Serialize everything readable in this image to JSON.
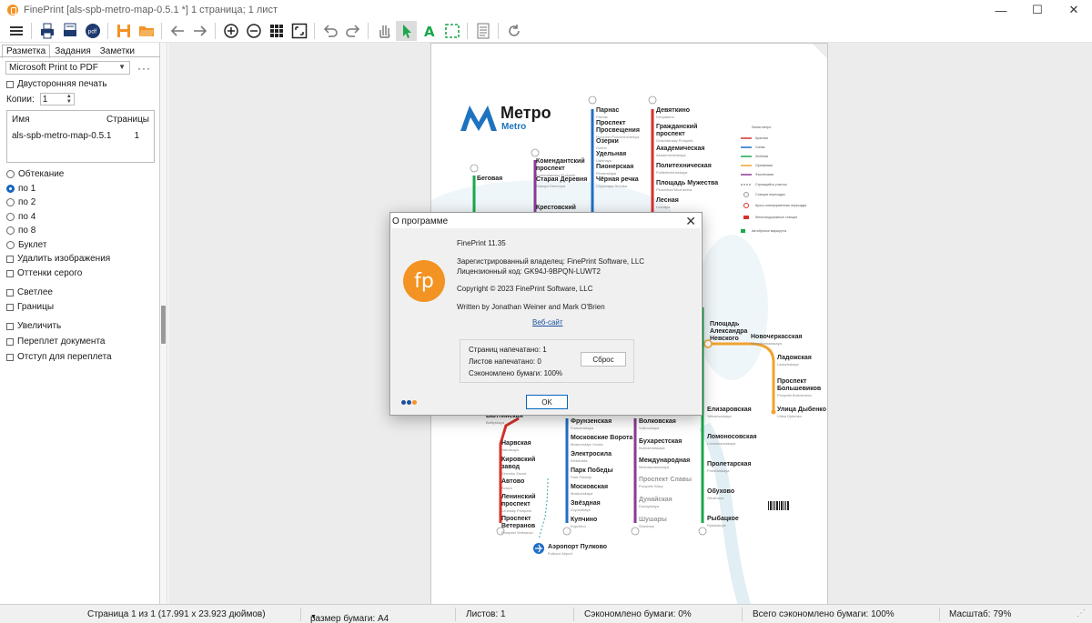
{
  "window": {
    "title": "FinePrint [als-spb-metro-map-0.5.1 *] 1 страница; 1 лист",
    "minimize": "—",
    "maximize": "☐",
    "close": "✕"
  },
  "toolbar": {
    "icons": [
      "menu-icon",
      "print-icon",
      "printer-settings-icon",
      "pdf-icon",
      "save-icon",
      "open-folder-icon",
      "back-arrow-icon",
      "forward-arrow-icon",
      "zoom-in-icon",
      "zoom-out-icon",
      "grid-view-icon",
      "fit-page-icon",
      "undo-icon",
      "redo-icon",
      "hand-icon",
      "select-pointer-icon",
      "text-icon",
      "crop-icon",
      "document-icon",
      "refresh-icon"
    ]
  },
  "left_panel": {
    "tabs": [
      "Разметка",
      "Задания",
      "Заметки"
    ],
    "printer": "Microsoft Print to PDF",
    "more": "···",
    "duplex_label": "Двусторонняя печать",
    "copies_label": "Копии:",
    "copies_value": "1",
    "jobs_header": {
      "name": "Имя",
      "pages": "Страницы"
    },
    "jobs": [
      {
        "name": "als-spb-metro-map-0.5.1",
        "pages": "1"
      }
    ],
    "layout_options": [
      {
        "label": "Обтекание",
        "selected": false
      },
      {
        "label": "по 1",
        "selected": true
      },
      {
        "label": "по 2",
        "selected": false
      },
      {
        "label": "по 4",
        "selected": false
      },
      {
        "label": "по 8",
        "selected": false
      },
      {
        "label": "Буклет",
        "selected": false
      }
    ],
    "checkboxes": {
      "remove_images": "Удалить изображения",
      "grayscale": "Оттенки серого",
      "lighter": "Светлее",
      "borders": "Границы",
      "enlarge": "Увеличить",
      "binding": "Переплет документа",
      "gutter": "Отступ для переплета"
    }
  },
  "metro_map": {
    "title": "Метро",
    "subtitle": "Metro",
    "stations": [
      {
        "name": "Парнас",
        "sub": "Parnas"
      },
      {
        "name": "Проспект Просвещения",
        "sub": "Prospekt Prosveshcheniya"
      },
      {
        "name": "Озерки",
        "sub": "Ozerki"
      },
      {
        "name": "Удельная",
        "sub": "Udelnaya"
      },
      {
        "name": "Пионерская",
        "sub": "Pionerskaya"
      },
      {
        "name": "Чёрная речка",
        "sub": "Chyornaya Rechka"
      },
      {
        "name": "Девяткино",
        "sub": "Devyatkino"
      },
      {
        "name": "Гражданский проспект",
        "sub": "Grazhdansky Prospekt"
      },
      {
        "name": "Академическая",
        "sub": "Akademicheskaya"
      },
      {
        "name": "Политехническая",
        "sub": "Politekhnicheskaya"
      },
      {
        "name": "Площадь Мужества",
        "sub": "Ploshchad Muzhestva"
      },
      {
        "name": "Лесная",
        "sub": "Lesnaya"
      },
      {
        "name": "Комендантский проспект",
        "sub": "Komendantsky Prospekt"
      },
      {
        "name": "Старая Деревня",
        "sub": "Staraya Derevnya"
      },
      {
        "name": "Крестовский",
        "sub": ""
      },
      {
        "name": "Беговая",
        "sub": ""
      },
      {
        "name": "Площадь Александра Невского",
        "sub": ""
      },
      {
        "name": "Новочеркасская",
        "sub": "Novocherkasskaya"
      },
      {
        "name": "Ладожская",
        "sub": "Ladozhskaya"
      },
      {
        "name": "Проспект Большевиков",
        "sub": "Prospekt Bolshevikov"
      },
      {
        "name": "Улица Дыбенко",
        "sub": "Ulitsa Dybenko"
      },
      {
        "name": "Елизаровская",
        "sub": "Yelizarovskaya"
      },
      {
        "name": "Ломоносовская",
        "sub": "Lomonosovskaya"
      },
      {
        "name": "Пролетарская",
        "sub": "Proletarskaya"
      },
      {
        "name": "Обухово",
        "sub": "Obukhovo"
      },
      {
        "name": "Рыбацкое",
        "sub": "Rybatskoye"
      },
      {
        "name": "Балтийская",
        "sub": "Baltiyskaya"
      },
      {
        "name": "Нарвская",
        "sub": "Narvskaya"
      },
      {
        "name": "Кировский завод",
        "sub": "Kirovsky Zavod"
      },
      {
        "name": "Автово",
        "sub": "Avtovo"
      },
      {
        "name": "Ленинский проспект",
        "sub": "Leninsky Prospekt"
      },
      {
        "name": "Проспект Ветеранов",
        "sub": "Prospekt Veteranov"
      },
      {
        "name": "Фрунзенская",
        "sub": "Frunzenskaya"
      },
      {
        "name": "Московские Ворота",
        "sub": "Moskovskiye Vorota"
      },
      {
        "name": "Электросила",
        "sub": "Elektrosila"
      },
      {
        "name": "Парк Победы",
        "sub": "Park Pobedy"
      },
      {
        "name": "Московская",
        "sub": "Moskovskaya"
      },
      {
        "name": "Звёздная",
        "sub": "Zvyozdnaya"
      },
      {
        "name": "Купчино",
        "sub": "Kupchino"
      },
      {
        "name": "Волковская",
        "sub": "Volkovskaya"
      },
      {
        "name": "Бухарестская",
        "sub": "Bukharestskaya"
      },
      {
        "name": "Международная",
        "sub": "Mezhdunarodnaya"
      },
      {
        "name": "Проспект Славы",
        "sub": "Prospekt Slavy"
      },
      {
        "name": "Дунайская",
        "sub": "Dunayskaya"
      },
      {
        "name": "Шушары",
        "sub": "Shushary"
      },
      {
        "name": "Аэропорт Пулково",
        "sub": "Pulkovo Airport"
      }
    ],
    "line_colors": {
      "red": "#d6312b",
      "blue": "#1f6fc5",
      "green": "#1aa84a",
      "orange": "#f0a22f",
      "purple": "#8a3b93",
      "teal": "#3aa7a4"
    },
    "legend": [
      "Линии метро",
      "Красная",
      "Синяя",
      "Зелёная",
      "Оранжевая",
      "Фиолетовая",
      "Строящийся участок",
      "Станция пересадки",
      "Кросс-платформенная пересадка",
      "Железнодорожные станции",
      "Автобусные маршруты"
    ]
  },
  "about_dialog": {
    "title": "О программе",
    "close": "✕",
    "logo_text": "fp",
    "version": "FinePrint 11.35",
    "owner": "Зарегистрированный владелец:  FinePrint Software, LLC",
    "license": "Лицензионный код:  GK94J-9BPQN-LUWT2",
    "copyright": "Copyright © 2023 FinePrint Software, LLC",
    "authors": "Written by Jonathan Weiner and Mark O'Brien",
    "website": "Веб-сайт",
    "pages_printed": "Страниц напечатано: 1",
    "sheets_printed": "Листов напечатано:     0",
    "paper_saved": "Сэкономлено бумаги:  100%",
    "reset": "Сброс",
    "ok": "OK",
    "dot_colors": [
      "#1f4e9c",
      "#1f4e9c",
      "#f39323"
    ]
  },
  "status": {
    "page_info": "Страница 1 из 1 (17.991 x 23.923 дюймов)",
    "paper_size": "размер бумаги: A4",
    "sheets": "Листов: 1",
    "paper_saved": "Сэкономлено бумаги: 0%",
    "total_saved": "Всего сэкономлено бумаги: 100%",
    "zoom": "Масштаб: 79%"
  }
}
